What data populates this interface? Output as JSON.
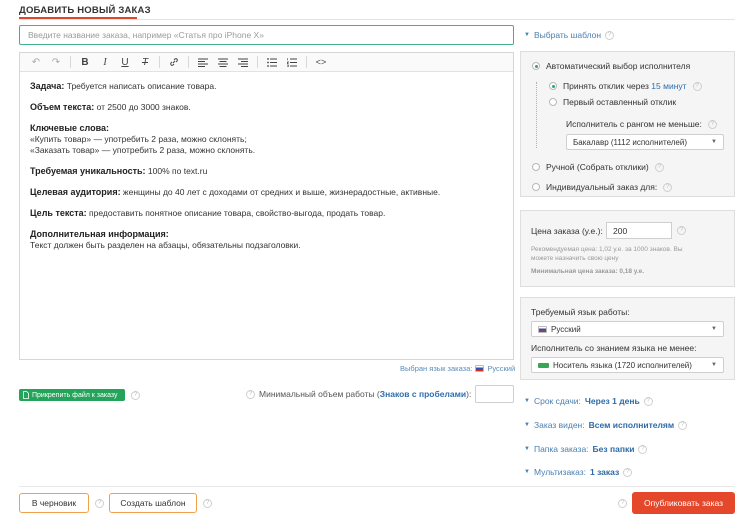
{
  "header": {
    "title": "ДОБАВИТЬ НОВЫЙ ЗАКАЗ"
  },
  "title_input": {
    "placeholder": "Введите название заказа, например «Статья про iPhone X»"
  },
  "editor": {
    "toolbar": [
      "undo-icon",
      "redo-icon",
      "bold-icon",
      "italic-icon",
      "underline-icon",
      "clear-format-icon",
      "link-icon",
      "align-left-icon",
      "align-center-icon",
      "align-right-icon",
      "bullet-list-icon",
      "numbered-list-icon",
      "code-icon"
    ],
    "task_label": "Задача:",
    "task_text": " Требуется написать описание товара.",
    "volume_label": "Объем текста:",
    "volume_text": " от 2500 до 3000 знаков.",
    "keywords_label": "Ключевые слова:",
    "keyword_1": "«Купить товар» — употребить 2 раза, можно склонять;",
    "keyword_2": "«Заказать товар» — употребить 2 раза, можно склонять.",
    "uniq_label": "Требуемая уникальность:",
    "uniq_text": " 100% по text.ru",
    "audience_label": "Целевая аудитория:",
    "audience_text": " женщины до 40 лет с доходами от средних и выше, жизнерадостные, активные.",
    "goal_label": "Цель текста:",
    "goal_text": " предоставить понятное описание товара, свойство-выгода, продать товар.",
    "extra_label": "Дополнительная информация:",
    "extra_text": "Текст должен быть разделен на абзацы, обязательны подзаголовки."
  },
  "lang_note": {
    "label": "Выбран язык заказа:",
    "value": "Русский"
  },
  "attach": {
    "label": "Прикрепить файл к заказу"
  },
  "minvol": {
    "label": "Минимальный объем работы (",
    "link": "Знаков с пробелами",
    "suffix": "):"
  },
  "buttons": {
    "draft": "В черновик",
    "template": "Создать шаблон",
    "publish": "Опубликовать заказ"
  },
  "sidebar": {
    "choose_template": "Выбрать шаблон",
    "auto_exec": "Автоматический выбор исполнителя",
    "accept_prefix": "Принять отклик через ",
    "accept_value": "15 минут",
    "first_response": "Первый оставленный отклик",
    "rank_label": "Исполнитель с рангом не меньше:",
    "rank_value": "Бакалавр (1112 исполнителей)",
    "manual": "Ручной (Собрать отклики)",
    "individual": "Индивидуальный заказ для:",
    "price_label": "Цена заказа (у.е.):",
    "price_value": "200",
    "price_hint_1": "Рекомендуемая цена: 1,02 у.е. за 1000 знаков. Вы",
    "price_hint_2": "можете назначить свою цену",
    "min_price": "Минимальная цена заказа: 0,18 у.е.",
    "lang_label": "Требуемый язык работы:",
    "lang_value": "Русский",
    "lang_level_label": "Исполнитель со знанием языка не менее:",
    "lang_level_value": "Носитель языка (1720 исполнителей)",
    "deadline_label": "Срок сдачи:",
    "deadline_value": "Через 1 день",
    "visible_label": "Заказ виден:",
    "visible_value": "Всем исполнителям",
    "folder_label": "Папка заказа:",
    "folder_value": "Без папки",
    "multi_label": "Мультизаказ:",
    "multi_value": "1 заказ"
  },
  "colors": {
    "accent_red": "#e5472b",
    "green": "#23a45a",
    "link_blue": "#4a7fb1",
    "orange_border": "#f0a24a"
  }
}
